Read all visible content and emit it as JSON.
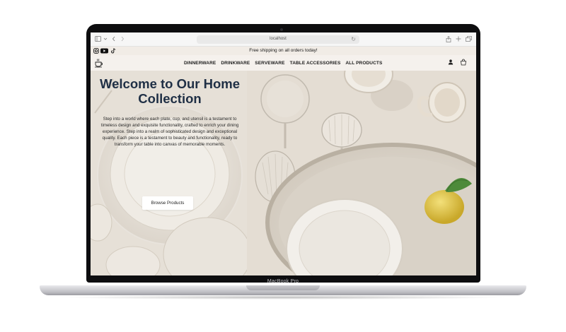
{
  "device": {
    "model_label": "MacBook Pro"
  },
  "browser": {
    "url": "localhost",
    "toolbar_icons": [
      "sidebar-icon",
      "chevron-down-icon",
      "back-icon",
      "forward-icon",
      "share-icon",
      "new-tab-icon",
      "tabs-icon"
    ]
  },
  "announcement": {
    "text": "Free shipping on all orders today!",
    "social_icons": [
      "instagram-icon",
      "youtube-icon",
      "tiktok-icon"
    ]
  },
  "nav": {
    "logo_icon": "coffee-cup-logo-icon",
    "items": [
      {
        "label": "DINNERWARE"
      },
      {
        "label": "DRINKWARE"
      },
      {
        "label": "SERVEWARE"
      },
      {
        "label": "TABLE ACCESSORIES"
      },
      {
        "label": "ALL PRODUCTS"
      }
    ],
    "right_icons": [
      "account-icon",
      "cart-icon"
    ]
  },
  "hero": {
    "title": "Welcome to Our Home Collection",
    "body": "Step into a world where each plate, cup, and utensil is a testament to timeless design and exquisite functionality, crafted to enrich your dining experience. Step into a realm of sophisticated design and exceptional quality. Each piece is a testament to beauty and functionality, ready to transform your table into canvas of memorable moments.",
    "cta_label": "Browse Products"
  },
  "colors": {
    "title": "#1f2f45",
    "announcement_bg": "#f1ece6",
    "button_bg": "#ffffff"
  }
}
